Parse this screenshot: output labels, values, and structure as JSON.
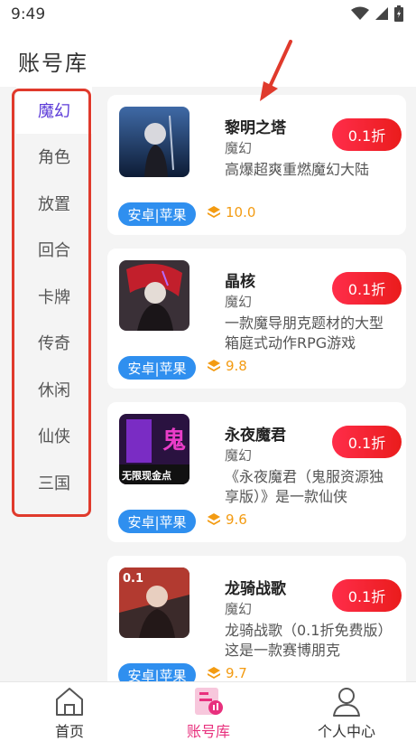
{
  "status_bar": {
    "time": "9:49",
    "icons": [
      "wifi-icon",
      "signal-icon",
      "battery-icon"
    ]
  },
  "header": {
    "title": "账号库"
  },
  "sidebar": {
    "items": [
      {
        "label": "魔幻",
        "active": true
      },
      {
        "label": "角色"
      },
      {
        "label": "放置"
      },
      {
        "label": "回合"
      },
      {
        "label": "卡牌"
      },
      {
        "label": "传奇"
      },
      {
        "label": "休闲"
      },
      {
        "label": "仙侠"
      },
      {
        "label": "三国"
      }
    ]
  },
  "games": [
    {
      "name": "黎明之塔",
      "category": "魔幻",
      "description": "高爆超爽重燃魔幻大陆",
      "discount": "0.1折",
      "platform": "安卓|苹果",
      "score": "10.0"
    },
    {
      "name": "晶核",
      "category": "魔幻",
      "description": "一款魔导朋克题材的大型箱庭式动作RPG游戏",
      "discount": "0.1折",
      "platform": "安卓|苹果",
      "score": "9.8"
    },
    {
      "name": "永夜魔君",
      "category": "魔幻",
      "description": "《永夜魔君（鬼服资源独享版）》是一款仙侠",
      "discount": "0.1折",
      "platform": "安卓|苹果",
      "score": "9.6",
      "thumb_text": "无限现金点"
    },
    {
      "name": "龙骑战歌",
      "category": "魔幻",
      "description": "龙骑战歌（0.1折免费版）这是一款赛博朋克",
      "discount": "0.1折",
      "platform": "安卓|苹果",
      "score": "9.7",
      "thumb_text": "0.1"
    }
  ],
  "tabbar": {
    "tabs": [
      {
        "label": "首页",
        "icon": "home-icon"
      },
      {
        "label": "账号库",
        "icon": "library-icon",
        "active": true
      },
      {
        "label": "个人中心",
        "icon": "user-icon"
      }
    ]
  },
  "colors": {
    "accent": "#e8307d",
    "sidebar_active": "#5b3ad8",
    "discount": "#ea1c1c",
    "platform_tag": "#2f8fef",
    "score": "#f39b12",
    "annotation": "#e03a2c"
  }
}
